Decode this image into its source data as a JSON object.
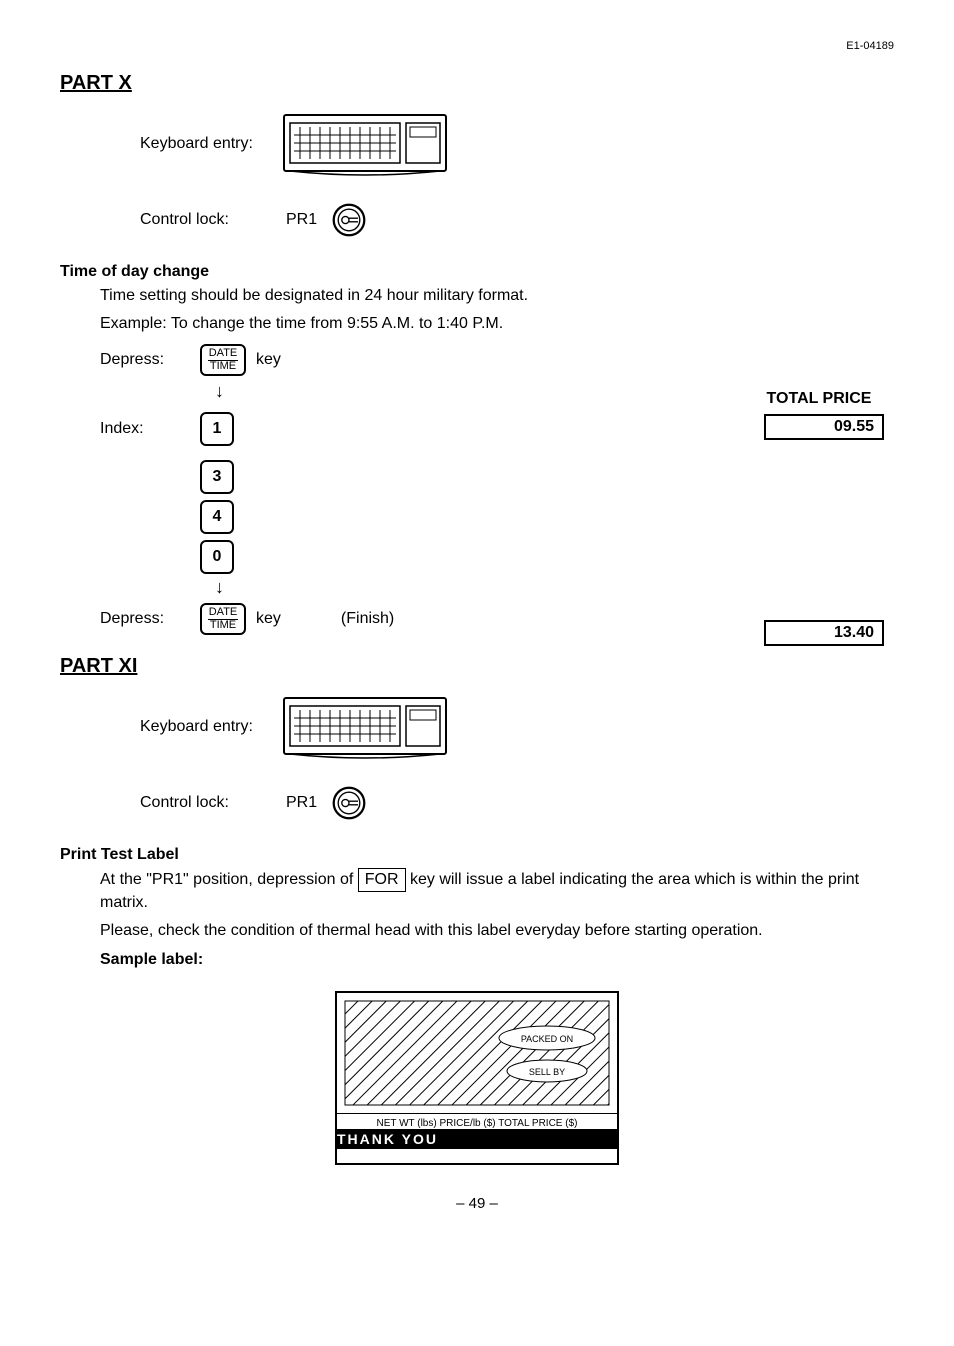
{
  "doc_id": "E1-04189",
  "partX": {
    "heading": "PART X",
    "keyboard_entry_label": "Keyboard entry:",
    "control_lock_label": "Control lock:",
    "control_lock_value": "PR1"
  },
  "time_change": {
    "heading": "Time of day change",
    "line1": "Time setting should be designated in 24 hour military format.",
    "line2": "Example: To change the time from 9:55 A.M. to 1:40 P.M.",
    "total_price_label": "TOTAL PRICE",
    "display1": "09.55",
    "display2": "13.40",
    "depress_label": "Depress:",
    "index_label": "Index:",
    "key_text": "key",
    "date_label": "DATE",
    "time_label": "TIME",
    "keys": [
      "1",
      "3",
      "4",
      "0"
    ],
    "finish_label": "(Finish)"
  },
  "partXI": {
    "heading": "PART XI",
    "keyboard_entry_label": "Keyboard entry:",
    "control_lock_label": "Control lock:",
    "control_lock_value": "PR1"
  },
  "print_test": {
    "heading": "Print Test Label",
    "line1a": "At the \"PR1\" position, depression of ",
    "for_key": "FOR",
    "line1b": " key will issue a label indicating the area which is within the print matrix.",
    "line2": "Please, check the condition of thermal head with this label everyday before starting operation.",
    "sample_label": "Sample label:",
    "footer_fields": "NET WT (lbs)   PRICE/lb ($)   TOTAL PRICE ($)",
    "thank_you": "THANK YOU",
    "packed_on": "PACKED ON",
    "sell_by": "SELL BY"
  },
  "page_number": "– 49 –"
}
